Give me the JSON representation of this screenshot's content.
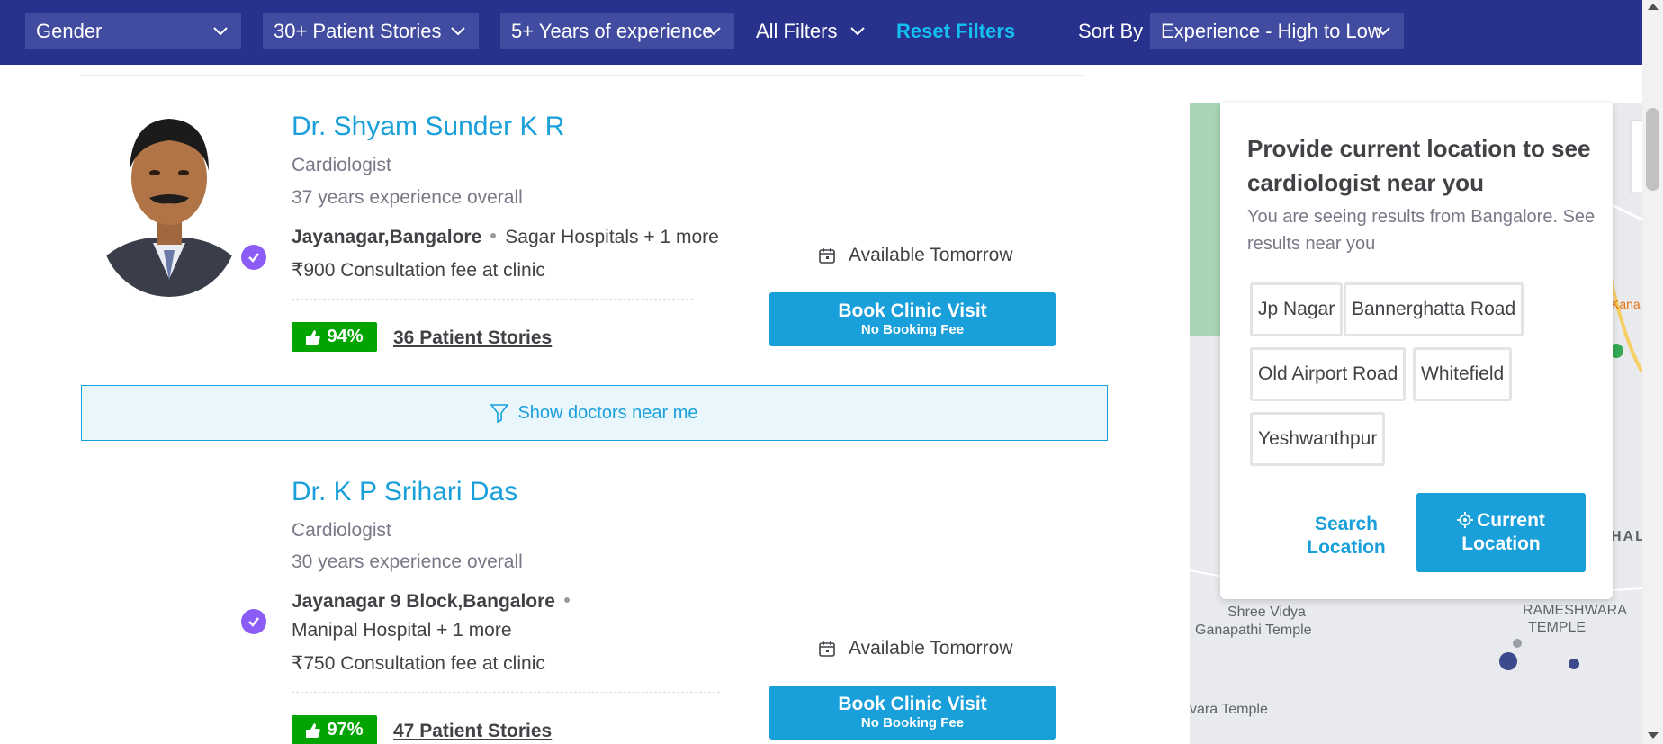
{
  "filters": {
    "gender": "Gender",
    "patient_stories": "30+ Patient Stories",
    "experience": "5+ Years of experience",
    "all_filters": "All Filters",
    "reset": "Reset Filters",
    "sort_by_label": "Sort By",
    "sort_by_value": "Experience - High to Low"
  },
  "doctors": [
    {
      "name": "Dr. Shyam Sunder K R",
      "specialty": "Cardiologist",
      "experience": "37 years experience overall",
      "locality": "Jayanagar,Bangalore",
      "clinic": "Sagar Hospitals + 1 more",
      "fee": "₹900 Consultation fee at clinic",
      "rating": "94%",
      "stories": "36 Patient Stories",
      "availability": "Available Tomorrow",
      "book_label": "Book Clinic Visit",
      "book_sub": "No Booking Fee"
    },
    {
      "name": "Dr. K P Srihari Das",
      "specialty": "Cardiologist",
      "experience": "30 years experience overall",
      "locality": "Jayanagar 9 Block,Bangalore",
      "clinic": "Manipal Hospital + 1 more",
      "fee": "₹750 Consultation fee at clinic",
      "rating": "97%",
      "stories": "47 Patient Stories",
      "availability": "Available Tomorrow",
      "book_label": "Book Clinic Visit",
      "book_sub": "No Booking Fee"
    }
  ],
  "near_me": "Show doctors near me",
  "location_popup": {
    "title": "Provide current location to see cardiologist near you",
    "subtitle": "You are seeing results from Bangalore. See results near you",
    "chips": [
      "Jp Nagar",
      "Bannerghatta Road",
      "Old Airport Road",
      "Whitefield",
      "Yeshwanthpur"
    ],
    "search_location": "Search Location",
    "current_location": "Current Location"
  },
  "map_labels": {
    "shree_vidya": "Shree Vidya",
    "ganapathi_temple": "Ganapathi Temple",
    "rameshwara": "RAMESHWARA",
    "temple": "TEMPLE",
    "vara_temple": "vara Temple",
    "kana": "Kana",
    "hal": "HAL"
  },
  "colors": {
    "nav_bg": "#28328c",
    "dropdown_bg": "#414ba0",
    "link_blue": "#199fd9",
    "rating_green": "#01a400",
    "verified_purple": "#8b5cf6"
  }
}
